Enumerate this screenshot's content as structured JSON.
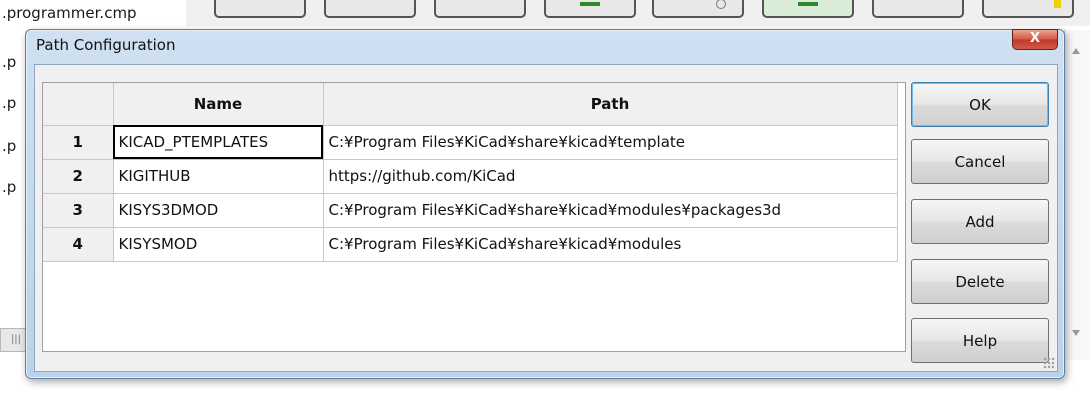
{
  "background": {
    "file_items": [
      ".programmer.cmp",
      ".p",
      ".p",
      ".p",
      ".p"
    ],
    "scroll_mark": "|||"
  },
  "dialog": {
    "title": "Path Configuration",
    "close_glyph": "X",
    "table": {
      "columns": [
        "Name",
        "Path"
      ],
      "rows": [
        {
          "num": "1",
          "name": "KICAD_PTEMPLATES",
          "path": "C:¥Program Files¥KiCad¥share¥kicad¥template"
        },
        {
          "num": "2",
          "name": "KIGITHUB",
          "path": "https://github.com/KiCad"
        },
        {
          "num": "3",
          "name": "KISYS3DMOD",
          "path": "C:¥Program Files¥KiCad¥share¥kicad¥modules¥packages3d"
        },
        {
          "num": "4",
          "name": "KISYSMOD",
          "path": "C:¥Program Files¥KiCad¥share¥kicad¥modules"
        }
      ]
    },
    "buttons": {
      "ok": "OK",
      "cancel": "Cancel",
      "add": "Add",
      "delete": "Delete",
      "help": "Help"
    }
  },
  "colors": {
    "title_gradient_top": "#cfe0f2",
    "close_button": "#c0392b",
    "selection_outline": "#000000"
  }
}
